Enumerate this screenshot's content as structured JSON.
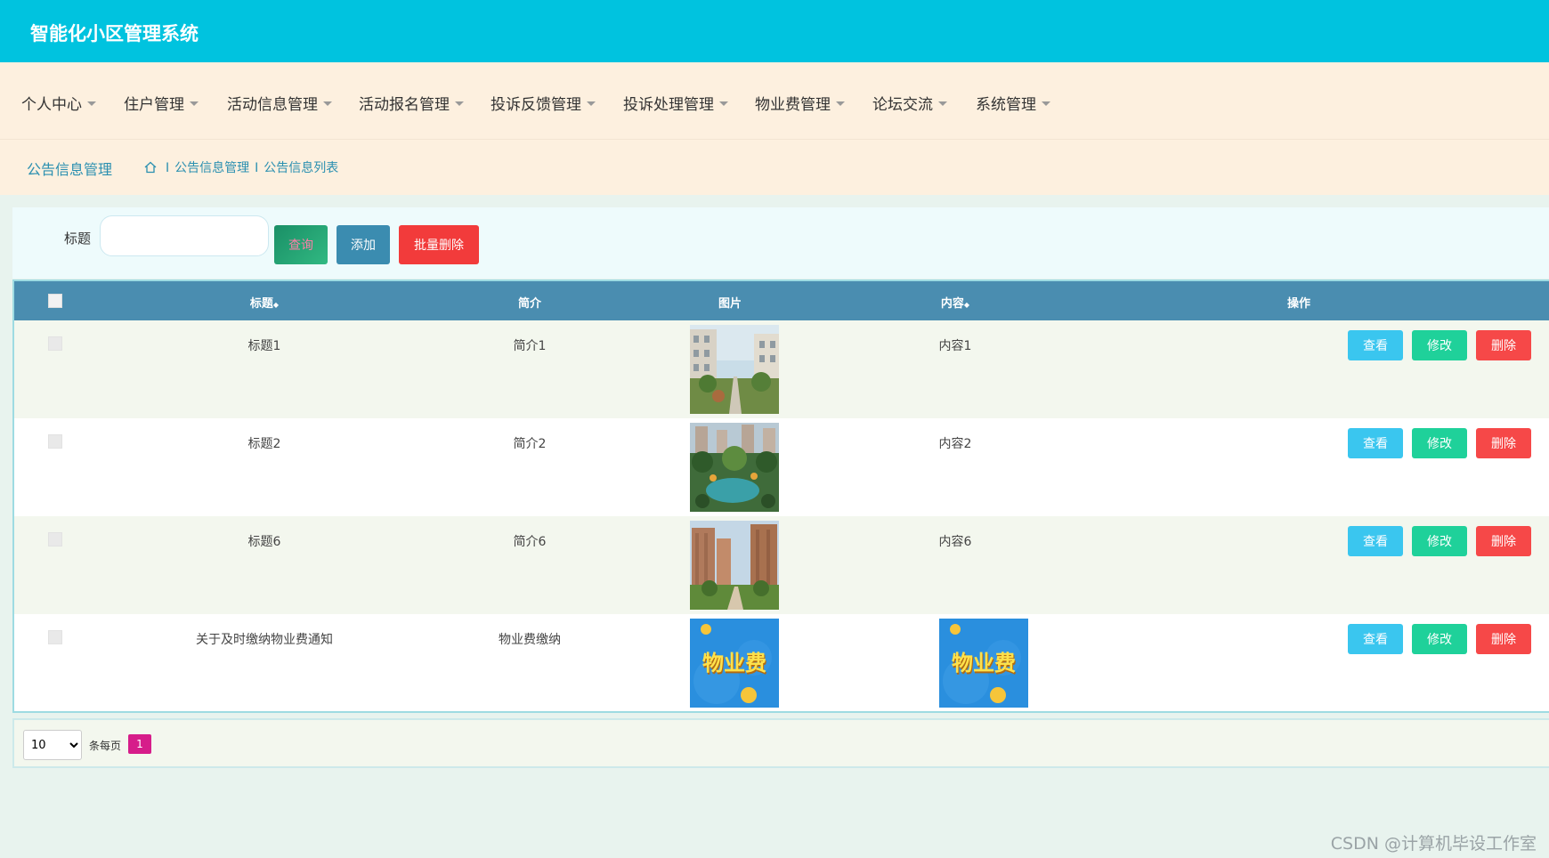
{
  "app": {
    "title": "智能化小区管理系统"
  },
  "nav": {
    "items": [
      {
        "label": "个人中心"
      },
      {
        "label": "住户管理"
      },
      {
        "label": "活动信息管理"
      },
      {
        "label": "活动报名管理"
      },
      {
        "label": "投诉反馈管理"
      },
      {
        "label": "投诉处理管理"
      },
      {
        "label": "物业费管理"
      },
      {
        "label": "论坛交流"
      },
      {
        "label": "系统管理"
      }
    ]
  },
  "breadcrumb": {
    "page_title": "公告信息管理",
    "trail": [
      "公告信息管理",
      "公告信息列表"
    ],
    "separator": "I"
  },
  "search": {
    "label": "标题",
    "value": "",
    "placeholder": "",
    "query_label": "查询",
    "add_label": "添加",
    "batch_delete_label": "批量删除"
  },
  "table": {
    "headers": {
      "title": "标题",
      "intro": "简介",
      "image": "图片",
      "content": "内容",
      "actions": "操作"
    },
    "sort_glyph": "◆",
    "rows": [
      {
        "title": "标题1",
        "intro": "简介1",
        "image": "community-walkway-photo",
        "content": "内容1",
        "content_image": null
      },
      {
        "title": "标题2",
        "intro": "简介2",
        "image": "garden-pond-photo",
        "content": "内容2",
        "content_image": null
      },
      {
        "title": "标题6",
        "intro": "简介6",
        "image": "apartment-towers-photo",
        "content": "内容6",
        "content_image": null
      },
      {
        "title": "关于及时缴纳物业费通知",
        "intro": "物业费缴纳",
        "image": "property-fee-poster",
        "content": "",
        "content_image": "property-fee-poster"
      }
    ],
    "poster_text": "物业费",
    "actions": {
      "view": "查看",
      "edit": "修改",
      "delete": "删除"
    }
  },
  "pager": {
    "page_size": "10",
    "page_size_options": [
      "10"
    ],
    "page_size_label": "条每页",
    "current_page": "1"
  },
  "watermark": "CSDN @计算机毕设工作室",
  "colors": {
    "topbar": "#00c3df",
    "nav_bg": "#fdf0df",
    "table_header": "#4a8db0",
    "view": "#3ac6ef",
    "edit": "#1fd19a",
    "delete": "#f64848",
    "page_active": "#d61d8a"
  }
}
